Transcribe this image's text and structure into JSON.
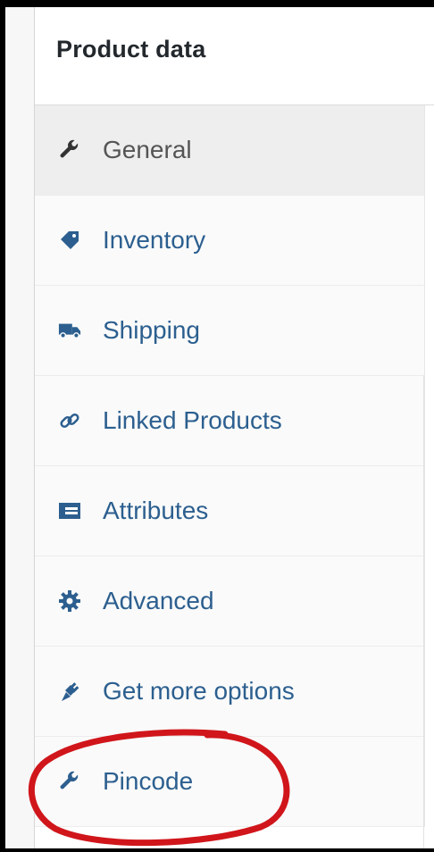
{
  "panel": {
    "title": "Product data"
  },
  "tabs": [
    {
      "label": "General",
      "icon": "wrench-icon",
      "active": true
    },
    {
      "label": "Inventory",
      "icon": "tag-icon",
      "active": false
    },
    {
      "label": "Shipping",
      "icon": "truck-icon",
      "active": false
    },
    {
      "label": "Linked Products",
      "icon": "link-icon",
      "active": false
    },
    {
      "label": "Attributes",
      "icon": "list-card-icon",
      "active": false
    },
    {
      "label": "Advanced",
      "icon": "gear-icon",
      "active": false
    },
    {
      "label": "Get more options",
      "icon": "plug-icon",
      "active": false
    },
    {
      "label": "Pincode",
      "icon": "wrench-icon",
      "active": false
    }
  ],
  "colors": {
    "tab_link": "#2c5f8f",
    "tab_active_text": "#555555",
    "annotation": "#d0161b"
  }
}
